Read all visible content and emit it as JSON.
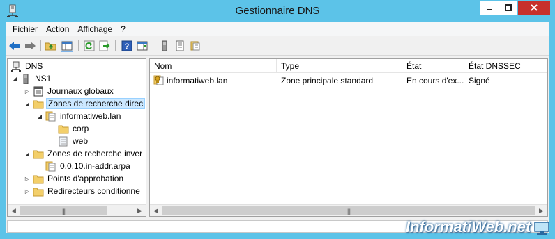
{
  "window": {
    "title": "Gestionnaire DNS"
  },
  "menu": {
    "file": "Fichier",
    "action": "Action",
    "view": "Affichage",
    "help": "?"
  },
  "tree": {
    "root": "DNS",
    "server": "NS1",
    "global_logs": "Journaux globaux",
    "forward_zones": "Zones de recherche direc",
    "zone": "informatiweb.lan",
    "sub_corp": "corp",
    "sub_web": "web",
    "reverse_zones": "Zones de recherche inver",
    "reverse_zone": "0.0.10.in-addr.arpa",
    "trust_points": "Points d'approbation",
    "conditional_forwarders": "Redirecteurs conditionne"
  },
  "list": {
    "columns": {
      "name": "Nom",
      "type": "Type",
      "state": "État",
      "dnssec": "État DNSSEC"
    },
    "rows": [
      {
        "name": "informatiweb.lan",
        "type": "Zone principale standard",
        "state": "En cours d'ex...",
        "dnssec": "Signé"
      }
    ]
  },
  "watermark": "InformatiWeb.net",
  "colors": {
    "frame": "#5cc3e8",
    "close": "#c7302b",
    "selection": "#cce8ff"
  }
}
